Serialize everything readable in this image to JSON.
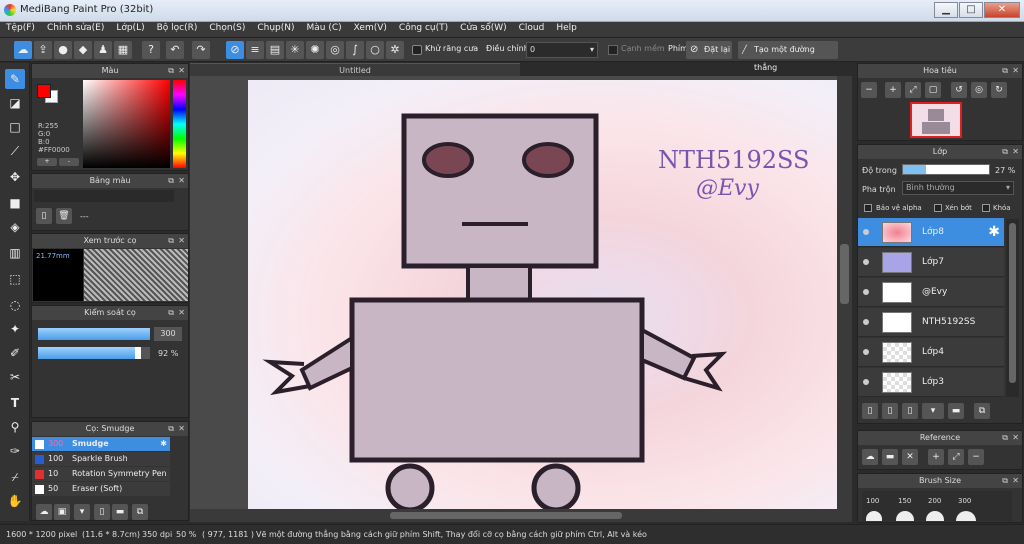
{
  "window": {
    "title": "MediBang Paint Pro (32bit)",
    "min_glyph": "▁",
    "max_glyph": "□",
    "close_glyph": "✕"
  },
  "menu": [
    "Tệp(F)",
    "Chỉnh sửa(E)",
    "Lớp(L)",
    "Bộ lọc(R)",
    "Chọn(S)",
    "Chụp(N)",
    "Màu (C)",
    "Xem(V)",
    "Công cụ(T)",
    "Cửa sổ(W)",
    "Cloud",
    "Help"
  ],
  "toolbar": {
    "antialias_label": "Khử răng cưa",
    "adjust_label": "Điều chỉnh",
    "adjust_value": "0",
    "soft_edge_label": "Cạnh mềm",
    "key_label": "Phím",
    "reset_label": "Đặt lại",
    "straight_line_label": "Tạo một đường thẳng"
  },
  "color_panel": {
    "title": "Màu",
    "r": "R:255",
    "g": "G:0",
    "b": "B:0",
    "hex": "#FF0000",
    "fg": "#ff0000",
    "bg": "#ffffff"
  },
  "swatch_panel": {
    "title": "Bảng màu",
    "value": "---"
  },
  "brush_preview": {
    "title": "Xem trước cọ",
    "size": "21.77mm"
  },
  "brush_control": {
    "title": "Kiểm soát cọ",
    "size_value": "300",
    "opacity_value": "92 %",
    "size_fraction": 1.0,
    "opacity_fraction": 0.92
  },
  "brush_list": {
    "title": "Cọ: Smudge",
    "items": [
      {
        "size": "300",
        "name": "Smudge",
        "color": "#ffffff"
      },
      {
        "size": "100",
        "name": "Sparkle Brush",
        "color": "#2a5bd7"
      },
      {
        "size": "10",
        "name": "Rotation Symmetry Pen",
        "color": "#e03030"
      },
      {
        "size": "50",
        "name": "Eraser (Soft)",
        "color": "#ffffff"
      }
    ]
  },
  "document": {
    "tab": "Untitled",
    "watermark_line1": "NTH5192SS",
    "watermark_line2": "@Evy"
  },
  "navigator": {
    "title": "Hoa tiêu"
  },
  "layer_panel": {
    "title": "Lớp",
    "opacity_label": "Độ trong",
    "opacity_value": "27 %",
    "opacity_fraction": 0.27,
    "blend_label": "Pha trộn",
    "blend_value": "Bình thường",
    "protect_alpha": "Bảo vệ alpha",
    "clipping": "Xén bớt",
    "lock": "Khóa",
    "layers": [
      {
        "name": "Lớp8",
        "thumb": "#f3c0c8"
      },
      {
        "name": "Lớp7",
        "thumb": "#a9a4e8"
      },
      {
        "name": "@Evy",
        "thumb": "#ffffff"
      },
      {
        "name": "NTH5192SS",
        "thumb": "#ffffff"
      },
      {
        "name": "Lớp4",
        "thumb": "#ffffff"
      },
      {
        "name": "Lớp3",
        "thumb": "#ffffff"
      }
    ]
  },
  "reference_panel": {
    "title": "Reference"
  },
  "brush_size_panel": {
    "title": "Brush Size",
    "sizes": [
      "100",
      "150",
      "200",
      "300"
    ]
  },
  "status": {
    "dims": "1600 * 1200 pixel",
    "physical": "(11.6 * 8.7cm)",
    "dpi": "350 dpi",
    "zoom": "50 %",
    "coords": "( 977, 1181 )",
    "hint": "Vẽ một đường thẳng bằng cách giữ phím Shift, Thay đổi cỡ cọ bằng cách giữ phím Ctrl, Alt và kéo"
  }
}
